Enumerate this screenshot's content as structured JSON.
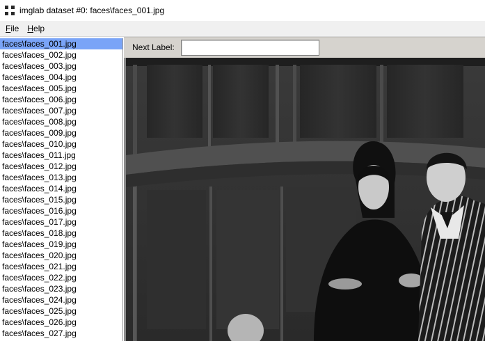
{
  "window": {
    "title": "imglab dataset #0: faces\\faces_001.jpg"
  },
  "menubar": {
    "file": {
      "mnemonic": "F",
      "rest": "ile"
    },
    "help": {
      "mnemonic": "H",
      "rest": "elp"
    }
  },
  "labelbar": {
    "label": "Next Label:",
    "value": ""
  },
  "filelist": {
    "selected_index": 0,
    "items": [
      "faces\\faces_001.jpg",
      "faces\\faces_002.jpg",
      "faces\\faces_003.jpg",
      "faces\\faces_004.jpg",
      "faces\\faces_005.jpg",
      "faces\\faces_006.jpg",
      "faces\\faces_007.jpg",
      "faces\\faces_008.jpg",
      "faces\\faces_009.jpg",
      "faces\\faces_010.jpg",
      "faces\\faces_011.jpg",
      "faces\\faces_012.jpg",
      "faces\\faces_013.jpg",
      "faces\\faces_014.jpg",
      "faces\\faces_015.jpg",
      "faces\\faces_016.jpg",
      "faces\\faces_017.jpg",
      "faces\\faces_018.jpg",
      "faces\\faces_019.jpg",
      "faces\\faces_020.jpg",
      "faces\\faces_021.jpg",
      "faces\\faces_022.jpg",
      "faces\\faces_023.jpg",
      "faces\\faces_024.jpg",
      "faces\\faces_025.jpg",
      "faces\\faces_026.jpg",
      "faces\\faces_027.jpg"
    ]
  },
  "icons": {
    "app": "imglab-app-icon"
  }
}
